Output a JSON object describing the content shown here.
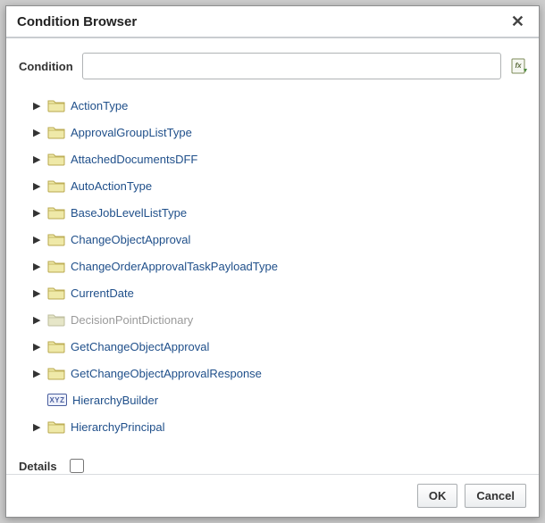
{
  "dialog": {
    "title": "Condition Browser",
    "close_glyph": "✕"
  },
  "condition": {
    "label": "Condition",
    "value": "",
    "placeholder": ""
  },
  "tree": [
    {
      "label": "ActionType",
      "kind": "folder",
      "expandable": true,
      "disabled": false
    },
    {
      "label": "ApprovalGroupListType",
      "kind": "folder",
      "expandable": true,
      "disabled": false
    },
    {
      "label": "AttachedDocumentsDFF",
      "kind": "folder",
      "expandable": true,
      "disabled": false
    },
    {
      "label": "AutoActionType",
      "kind": "folder",
      "expandable": true,
      "disabled": false
    },
    {
      "label": "BaseJobLevelListType",
      "kind": "folder",
      "expandable": true,
      "disabled": false
    },
    {
      "label": "ChangeObjectApproval",
      "kind": "folder",
      "expandable": true,
      "disabled": false
    },
    {
      "label": "ChangeOrderApprovalTaskPayloadType",
      "kind": "folder",
      "expandable": true,
      "disabled": false
    },
    {
      "label": "CurrentDate",
      "kind": "folder",
      "expandable": true,
      "disabled": false
    },
    {
      "label": "DecisionPointDictionary",
      "kind": "folder",
      "expandable": true,
      "disabled": true
    },
    {
      "label": "GetChangeObjectApproval",
      "kind": "folder",
      "expandable": true,
      "disabled": false
    },
    {
      "label": "GetChangeObjectApprovalResponse",
      "kind": "folder",
      "expandable": true,
      "disabled": false
    },
    {
      "label": "HierarchyBuilder",
      "kind": "leaf",
      "expandable": false,
      "disabled": false
    },
    {
      "label": "HierarchyPrincipal",
      "kind": "folder",
      "expandable": true,
      "disabled": false
    }
  ],
  "leaf_badge_text": "XYZ",
  "details": {
    "label": "Details",
    "checked": false
  },
  "footer": {
    "ok": "OK",
    "cancel": "Cancel"
  }
}
